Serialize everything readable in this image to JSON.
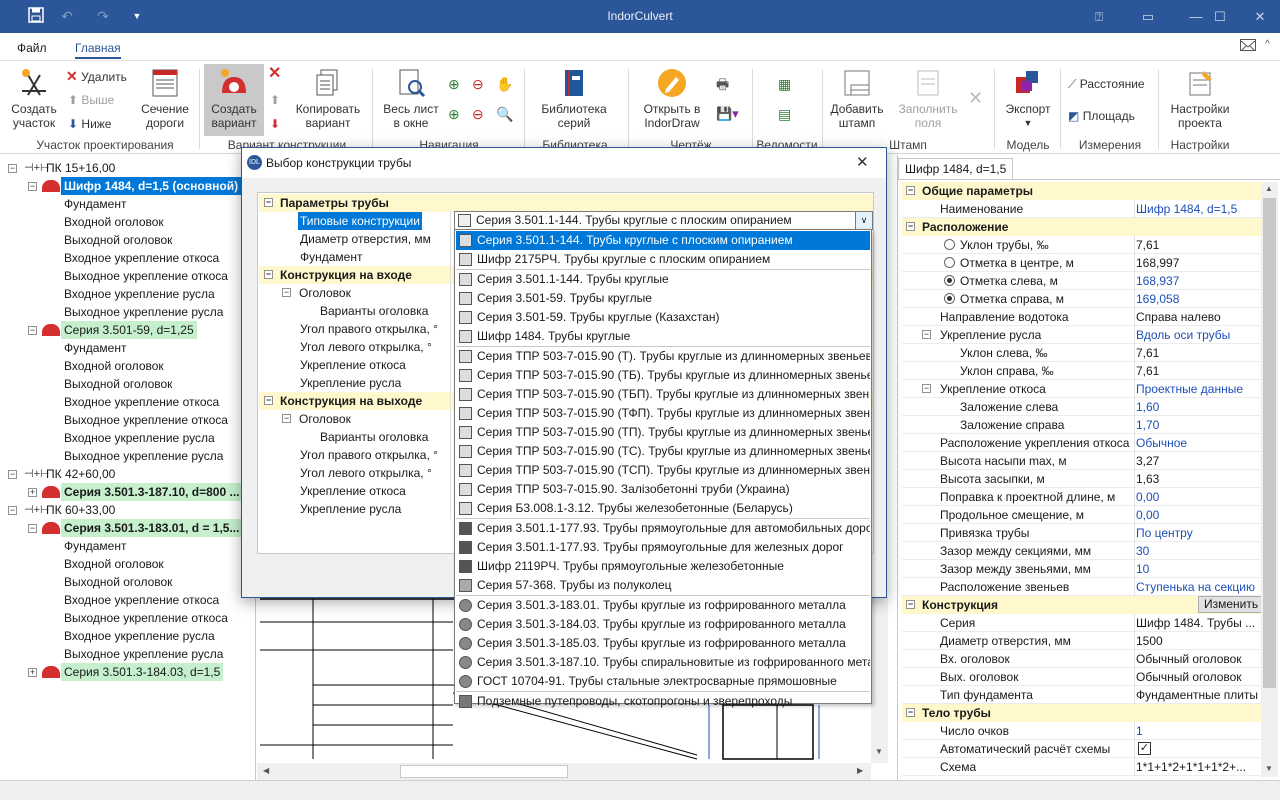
{
  "window": {
    "title": "IndorCulvert"
  },
  "menu": {
    "file": "Файл",
    "home": "Главная"
  },
  "ribbon": {
    "create_section": "Создать\nучасток",
    "create_section_l1": "Создать",
    "create_section_l2": "участок",
    "delete": "Удалить",
    "up": "Выше",
    "down": "Ниже",
    "road_section_l1": "Сечение",
    "road_section_l2": "дороги",
    "group1": "Участок проектирования",
    "create_variant_l1": "Создать",
    "create_variant_l2": "вариант",
    "copy_variant_l1": "Копировать",
    "copy_variant_l2": "вариант",
    "group2": "Вариант конструкции",
    "whole_sheet_l1": "Весь лист",
    "whole_sheet_l2": "в окне",
    "group3": "Навигация",
    "library_l1": "Библиотека",
    "library_l2": "серий",
    "group4": "Библиотека серий",
    "open_indor_l1": "Открыть в",
    "open_indor_l2": "IndorDraw",
    "group5": "Чертёж",
    "group6": "Ведомости",
    "add_stamp_l1": "Добавить",
    "add_stamp_l2": "штамп",
    "fill_fields_l1": "Заполнить",
    "fill_fields_l2": "поля",
    "group7": "Штамп",
    "export": "Экспорт",
    "group8": "Модель",
    "distance": "Расстояние",
    "area": "Площадь",
    "group9": "Измерения",
    "project_settings_l1": "Настройки",
    "project_settings_l2": "проекта",
    "group10": "Настройки"
  },
  "tree": [
    {
      "label": "ПК 15+16,00",
      "level": 0
    },
    {
      "label": "Шифр 1484, d=1,5 (основной)",
      "level": 1,
      "style": "blue"
    },
    {
      "label": "Фундамент",
      "level": 2
    },
    {
      "label": "Входной оголовок",
      "level": 2
    },
    {
      "label": "Выходной оголовок",
      "level": 2
    },
    {
      "label": "Входное укрепление откоса",
      "level": 2
    },
    {
      "label": "Выходное укрепление откоса",
      "level": 2
    },
    {
      "label": "Входное укрепление русла",
      "level": 2
    },
    {
      "label": "Выходное укрепление русла",
      "level": 2
    },
    {
      "label": "Серия 3.501-59, d=1,25",
      "level": 1,
      "style": "green"
    },
    {
      "label": "Фундамент",
      "level": 2
    },
    {
      "label": "Входной оголовок",
      "level": 2
    },
    {
      "label": "Выходной оголовок",
      "level": 2
    },
    {
      "label": "Входное укрепление откоса",
      "level": 2
    },
    {
      "label": "Выходное укрепление откоса",
      "level": 2
    },
    {
      "label": "Входное укрепление русла",
      "level": 2
    },
    {
      "label": "Выходное укрепление русла",
      "level": 2
    },
    {
      "label": "ПК 42+60,00",
      "level": 0
    },
    {
      "label": "Серия 3.501.3-187.10, d=800 ...",
      "level": 1,
      "style": "greenb"
    },
    {
      "label": "ПК 60+33,00",
      "level": 0
    },
    {
      "label": "Серия 3.501.3-183.01, d = 1,5...",
      "level": 1,
      "style": "greenb"
    },
    {
      "label": "Фундамент",
      "level": 2
    },
    {
      "label": "Входной оголовок",
      "level": 2
    },
    {
      "label": "Выходной оголовок",
      "level": 2
    },
    {
      "label": "Входное укрепление откоса",
      "level": 2
    },
    {
      "label": "Выходное укрепление откоса",
      "level": 2
    },
    {
      "label": "Входное укрепление русла",
      "level": 2
    },
    {
      "label": "Выходное укрепление русла",
      "level": 2
    },
    {
      "label": "Серия 3.501.3-184.03, d=1,5",
      "level": 1,
      "style": "green"
    }
  ],
  "dialog": {
    "title": "Выбор конструкции трубы",
    "cat1": "Параметры трубы",
    "typical": "Типовые конструкции",
    "diameter": "Диаметр отверстия, мм",
    "foundation": "Фундамент",
    "cat2": "Конструкция на входе",
    "head": "Оголовок",
    "head_variants": "Варианты оголовка",
    "right_angle": "Угол правого открылка, °",
    "left_angle": "Угол левого открылка, °",
    "slope_fix": "Укрепление откоса",
    "bed_fix": "Укрепление русла",
    "cat3": "Конструкция на выходе",
    "combo_value": "Серия 3.501.1-144. Трубы круглые с плоским опиранием"
  },
  "dropdown": [
    "Серия 3.501.1-144. Трубы круглые с плоским опиранием",
    "Шифр 2175РЧ. Трубы круглые с плоским опиранием",
    "Серия 3.501.1-144. Трубы круглые",
    "Серия 3.501-59. Трубы круглые",
    "Серия 3.501-59. Трубы круглые (Казахстан)",
    "Шифр 1484. Трубы круглые",
    "Серия ТПР 503-7-015.90 (Т). Трубы круглые из длинномерных звеньев",
    "Серия ТПР 503-7-015.90 (ТБ). Трубы круглые из длинномерных звеньев",
    "Серия ТПР 503-7-015.90 (ТБП). Трубы круглые из длинномерных звеньев",
    "Серия ТПР 503-7-015.90 (ТФП). Трубы круглые из длинномерных звеньев",
    "Серия ТПР 503-7-015.90 (ТП). Трубы круглые из длинномерных звеньев",
    "Серия ТПР 503-7-015.90 (ТС). Трубы круглые из длинномерных звеньев",
    "Серия ТПР 503-7-015.90 (ТСП). Трубы круглые из длинномерных звеньев",
    "Серия ТПР 503-7-015.90. Залізобетонні труби (Украина)",
    "Серия Б3.008.1-3.12. Трубы железобетонные (Беларусь)",
    "Серия 3.501.1-177.93. Трубы прямоугольные для автомобильных дорог",
    "Серия 3.501.1-177.93. Трубы прямоугольные для железных дорог",
    "Шифр 2119РЧ. Трубы прямоугольные железобетонные",
    "Серия 57-368. Трубы из полуколец",
    "Серия 3.501.3-183.01. Трубы круглые из гофрированного металла",
    "Серия 3.501.3-184.03. Трубы круглые из гофрированного металла",
    "Серия 3.501.3-185.03. Трубы круглые из гофрированного металла",
    "Серия 3.501.3-187.10. Трубы спиральновитые из гофрированного металла",
    "ГОСТ 10704-91. Трубы стальные электросварные прямошовные",
    "Подземные путепроводы, скотопрогоны и зверепроходы"
  ],
  "props": {
    "tab": "Шифр 1484, d=1,5",
    "rows": [
      {
        "t": "cat",
        "n": "Общие параметры"
      },
      {
        "n": "Наименование",
        "v": "Шифр 1484, d=1,5",
        "blue": true,
        "i": 1
      },
      {
        "t": "cat",
        "n": "Расположение"
      },
      {
        "n": "Уклон трубы, ‰",
        "v": "7,61",
        "i": 1,
        "radio": "off"
      },
      {
        "n": "Отметка в центре, м",
        "v": "168,997",
        "i": 1,
        "radio": "off"
      },
      {
        "n": "Отметка слева, м",
        "v": "168,937",
        "blue": true,
        "i": 1,
        "radio": "on"
      },
      {
        "n": "Отметка справа, м",
        "v": "169,058",
        "blue": true,
        "i": 1,
        "radio": "on"
      },
      {
        "n": "Направление водотока",
        "v": "Справа налево",
        "i": 1
      },
      {
        "n": "Укрепление русла",
        "v": "Вдоль оси трубы",
        "blue": true,
        "i": 1,
        "exp": true
      },
      {
        "n": "Уклон слева, ‰",
        "v": "7,61",
        "i": 2
      },
      {
        "n": "Уклон справа, ‰",
        "v": "7,61",
        "i": 2
      },
      {
        "n": "Укрепление откоса",
        "v": "Проектные данные",
        "blue": true,
        "i": 1,
        "exp": true
      },
      {
        "n": "Заложение слева",
        "v": "1,60",
        "blue": true,
        "i": 2
      },
      {
        "n": "Заложение справа",
        "v": "1,70",
        "blue": true,
        "i": 2
      },
      {
        "n": "Расположение укрепления откоса",
        "v": "Обычное",
        "blue": true,
        "i": 1
      },
      {
        "n": "Высота насыпи max, м",
        "v": "3,27",
        "i": 1
      },
      {
        "n": "Высота засыпки, м",
        "v": "1,63",
        "i": 1
      },
      {
        "n": "Поправка к проектной длине, м",
        "v": "0,00",
        "blue": true,
        "i": 1
      },
      {
        "n": "Продольное смещение, м",
        "v": "0,00",
        "blue": true,
        "i": 1
      },
      {
        "n": "Привязка трубы",
        "v": "По центру",
        "blue": true,
        "i": 1
      },
      {
        "n": "Зазор между секциями, мм",
        "v": "30",
        "blue": true,
        "i": 1
      },
      {
        "n": "Зазор между звеньями, мм",
        "v": "10",
        "blue": true,
        "i": 1
      },
      {
        "n": "Расположение звеньев",
        "v": "Ступенька на секцию",
        "blue": true,
        "i": 1
      },
      {
        "t": "cat",
        "n": "Конструкция",
        "btn": "Изменить"
      },
      {
        "n": "Серия",
        "v": "Шифр 1484. Трубы ...",
        "i": 1
      },
      {
        "n": "Диаметр отверстия, мм",
        "v": "1500",
        "i": 1
      },
      {
        "n": "Вх. оголовок",
        "v": "Обычный оголовок",
        "i": 1
      },
      {
        "n": "Вых. оголовок",
        "v": "Обычный оголовок",
        "i": 1
      },
      {
        "n": "Тип фундамента",
        "v": "Фундаментные плиты",
        "i": 1
      },
      {
        "t": "cat",
        "n": "Тело трубы"
      },
      {
        "n": "Число очков",
        "v": "1",
        "blue": true,
        "i": 1
      },
      {
        "n": "Автоматический расчёт схемы",
        "v": "",
        "i": 1,
        "check": true
      },
      {
        "n": "Схема",
        "v": "1*1+1*2+1*1+1*2+...",
        "i": 1
      }
    ]
  },
  "colors": {
    "titlebar": "#2b579a",
    "selection": "#0078d7",
    "green": "#c6efce",
    "category": "#fff8cc"
  }
}
